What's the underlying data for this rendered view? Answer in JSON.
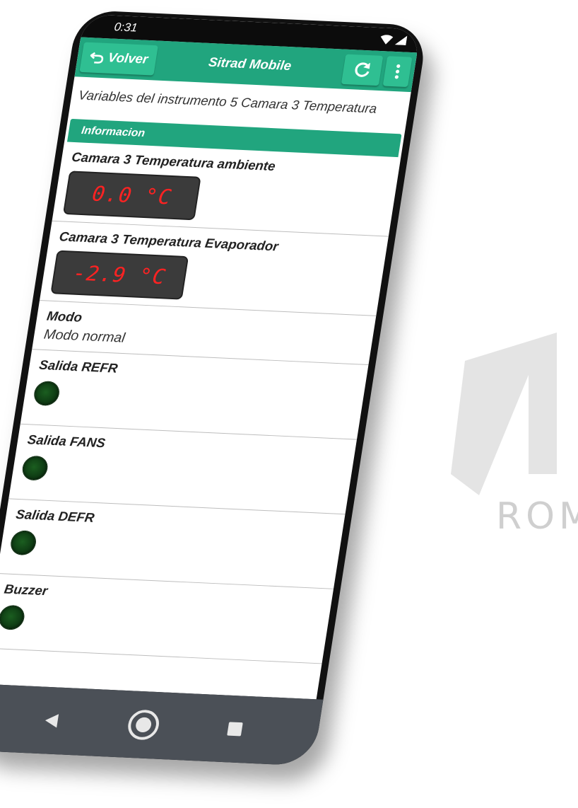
{
  "status_bar": {
    "time": "0:31",
    "icons": [
      "wifi-icon",
      "signal-icon"
    ]
  },
  "app_bar": {
    "back_label": "Volver",
    "back_icon": "undo-arrow-icon",
    "title": "Sitrad Mobile",
    "refresh_icon": "refresh-icon",
    "menu_icon": "overflow-menu-icon",
    "color": "#21a57e"
  },
  "subtitle": "Variables del instrumento 5 Camara 3 Temperatura",
  "section": {
    "title": "Informacion"
  },
  "items": {
    "temp_ambiente": {
      "title": "Camara 3 Temperatura ambiente",
      "value": "0.0 °C"
    },
    "temp_evaporador": {
      "title": "Camara 3 Temperatura Evaporador",
      "value": "-2.9 °C"
    },
    "modo": {
      "title": "Modo",
      "value": "Modo normal"
    },
    "salida_refr": {
      "title": "Salida REFR",
      "state": "off"
    },
    "salida_fans": {
      "title": "Salida FANS",
      "state": "off"
    },
    "salida_defr": {
      "title": "Salida DEFR",
      "state": "off"
    },
    "buzzer": {
      "title": "Buzzer",
      "state": "off"
    }
  },
  "nav_bar": {
    "back_icon": "nav-back-icon",
    "home_icon": "nav-home-icon",
    "recents_icon": "nav-recents-icon"
  },
  "background": {
    "logo_text": "ROM"
  },
  "colors": {
    "lcd_digits": "#ff2222",
    "led_off": "#1b5e20"
  }
}
